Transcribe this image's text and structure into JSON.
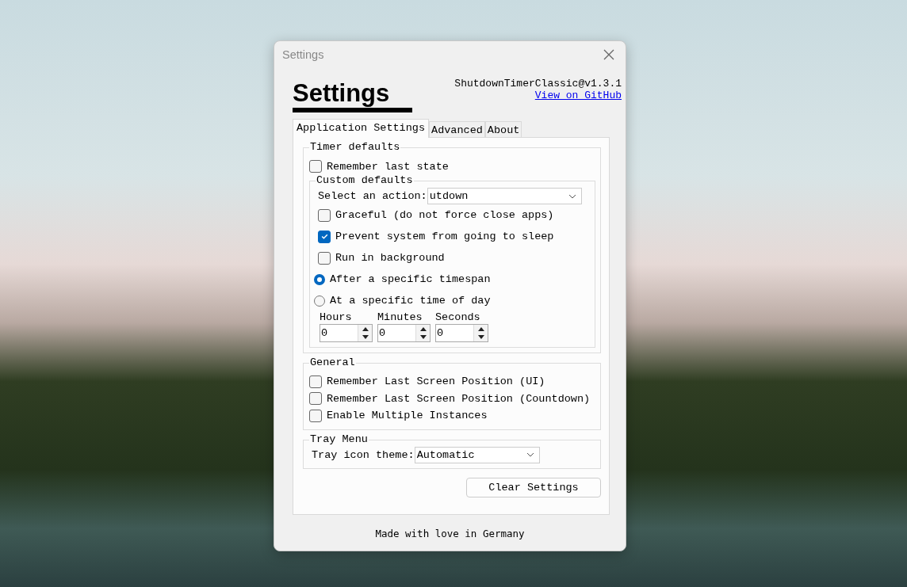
{
  "window": {
    "title": "Settings"
  },
  "header": {
    "heading": "Settings",
    "version": "ShutdownTimerClassic@v1.3.1",
    "link": "View on GitHub"
  },
  "tabs": [
    {
      "label": "Application Settings",
      "selected": true
    },
    {
      "label": "Advanced",
      "selected": false
    },
    {
      "label": "About",
      "selected": false
    }
  ],
  "timer_defaults": {
    "title": "Timer defaults",
    "remember": {
      "label": "Remember last state",
      "checked": false
    },
    "custom_defaults": {
      "title": "Custom defaults",
      "action_label": "Select an action:",
      "action_value": "utdown",
      "options": [
        {
          "kind": "checkbox",
          "label": "Graceful (do not force close apps)",
          "checked": false
        },
        {
          "kind": "checkbox",
          "label": "Prevent system from going to sleep",
          "checked": true
        },
        {
          "kind": "checkbox",
          "label": "Run in background",
          "checked": false
        },
        {
          "kind": "radio",
          "label": "After a specific timespan",
          "selected": true
        },
        {
          "kind": "radio",
          "label": "At a specific time of day",
          "selected": false
        }
      ],
      "fields": [
        {
          "label": "Hours",
          "value": "0"
        },
        {
          "label": "Minutes",
          "value": "0"
        },
        {
          "label": "Seconds",
          "value": "0"
        }
      ]
    }
  },
  "general": {
    "title": "General",
    "options": [
      {
        "label": "Remember Last Screen Position (UI)",
        "checked": false
      },
      {
        "label": "Remember Last Screen Position (Countdown)",
        "checked": false
      },
      {
        "label": "Enable Multiple Instances",
        "checked": false
      }
    ]
  },
  "tray_menu": {
    "title": "Tray Menu",
    "theme_label": "Tray icon theme:",
    "theme_value": "Automatic"
  },
  "clear_button": "Clear Settings",
  "footer": "Made with love in Germany"
}
